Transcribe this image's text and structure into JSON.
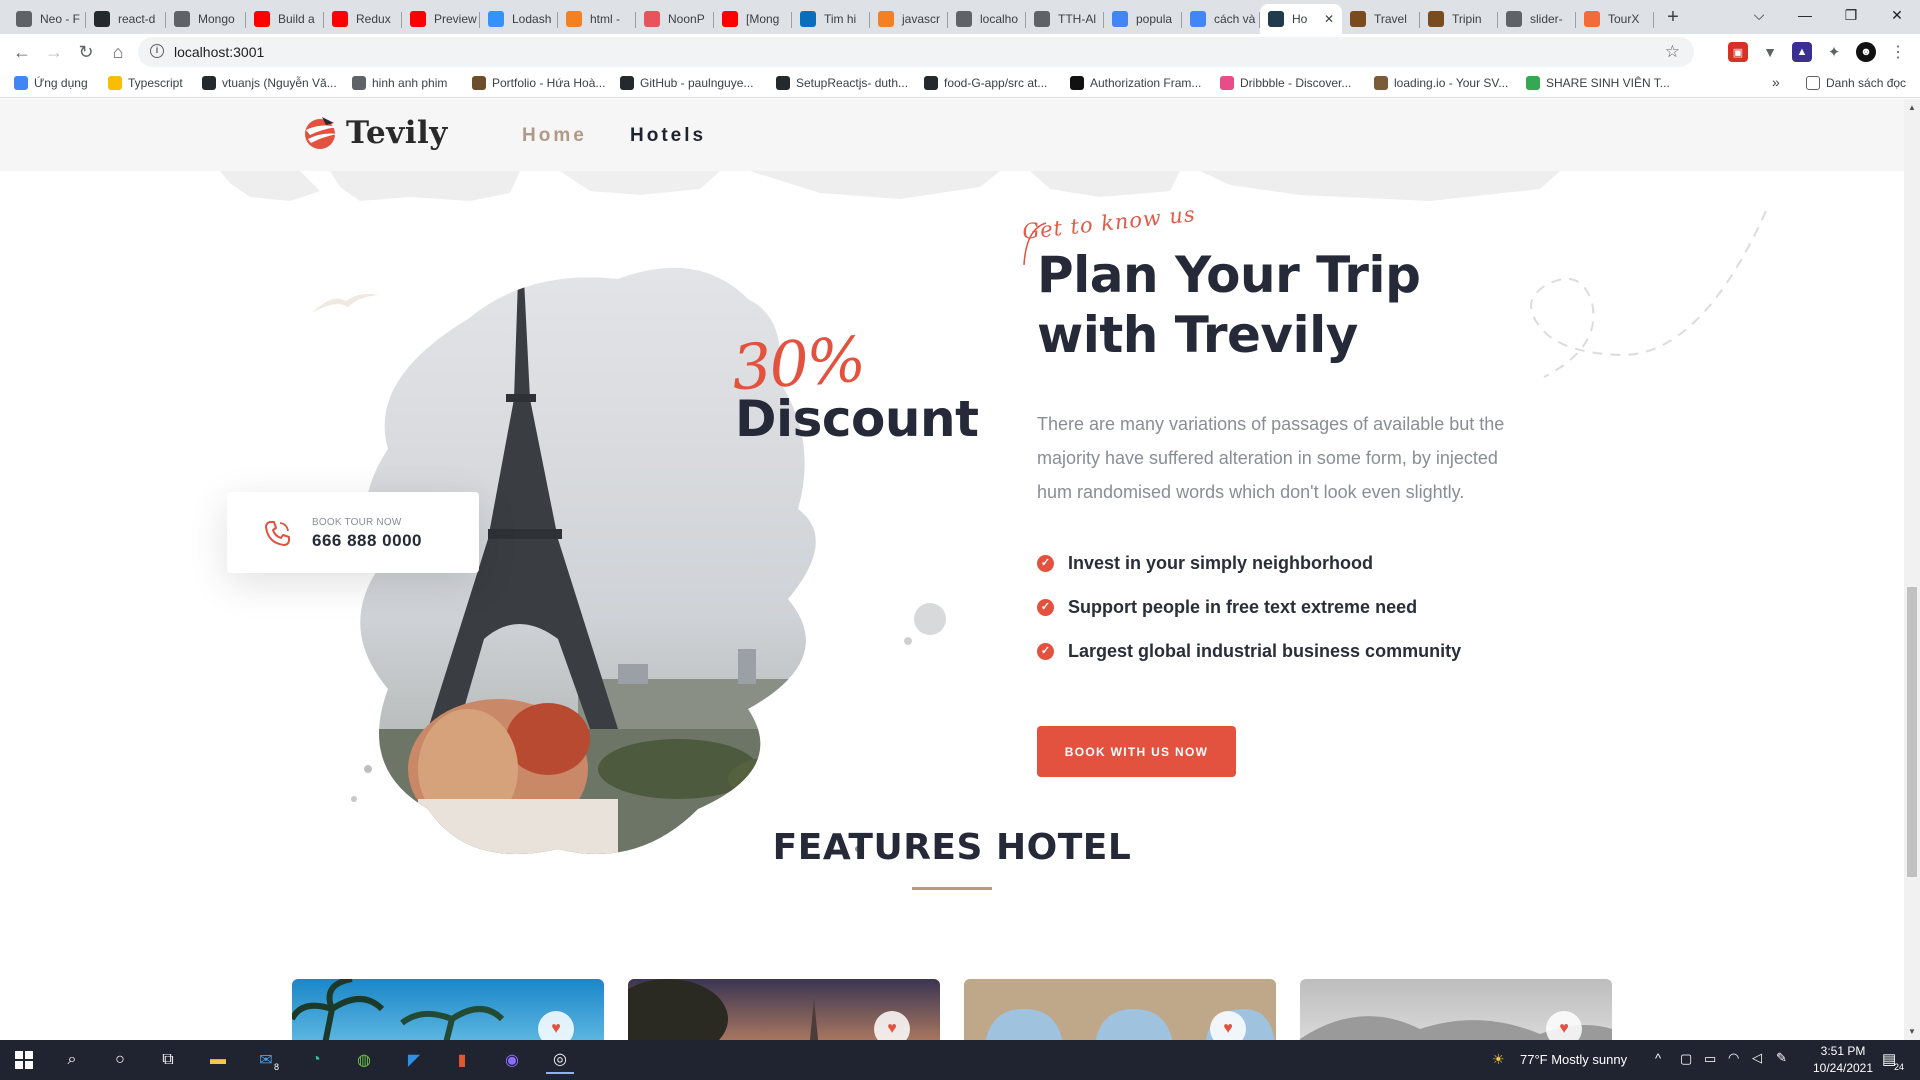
{
  "browser": {
    "tabs": [
      {
        "title": "Neo - F",
        "color": "#5f6368"
      },
      {
        "title": "react-d",
        "color": "#24292e"
      },
      {
        "title": "Mongo",
        "color": "#5f6368"
      },
      {
        "title": "Build a",
        "color": "#ff0000"
      },
      {
        "title": "Redux",
        "color": "#ff0000"
      },
      {
        "title": "Preview",
        "color": "#ff0000"
      },
      {
        "title": "Lodash",
        "color": "#3492ff"
      },
      {
        "title": "html -",
        "color": "#f48024"
      },
      {
        "title": "NoonP",
        "color": "#e8545c"
      },
      {
        "title": "[Mong",
        "color": "#ff0000"
      },
      {
        "title": "Tim hi",
        "color": "#0a6ebd"
      },
      {
        "title": "javascr",
        "color": "#f48024"
      },
      {
        "title": "localho",
        "color": "#5f6368"
      },
      {
        "title": "TTH-Al",
        "color": "#5f6368"
      },
      {
        "title": "popula",
        "color": "#4285f4"
      },
      {
        "title": "cách và",
        "color": "#4285f4"
      },
      {
        "title": "Ho",
        "color": "#1f3b4d",
        "active": true
      },
      {
        "title": "Travel",
        "color": "#7a4b1f"
      },
      {
        "title": "Tripin",
        "color": "#7a4b1f"
      },
      {
        "title": "slider-",
        "color": "#5f6368"
      },
      {
        "title": "TourX",
        "color": "#f36b3b"
      }
    ],
    "url": "localhost:3001",
    "bookmarks": [
      {
        "label": "Ứng dụng",
        "color": "#4285f4"
      },
      {
        "label": "Typescript",
        "color": "#fbbc05"
      },
      {
        "label": "vtuanjs (Nguyễn Vă...",
        "color": "#24292e"
      },
      {
        "label": "hinh anh phim",
        "color": "#5f6368"
      },
      {
        "label": "Portfolio - Hứa Hoà...",
        "color": "#6b4f2a"
      },
      {
        "label": "GitHub - paulnguye...",
        "color": "#24292e"
      },
      {
        "label": "SetupReactjs- duth...",
        "color": "#24292e"
      },
      {
        "label": "food-G-app/src at...",
        "color": "#24292e"
      },
      {
        "label": "Authorization Fram...",
        "color": "#111111"
      },
      {
        "label": "Dribbble - Discover...",
        "color": "#ea4c89"
      },
      {
        "label": "loading.io - Your SV...",
        "color": "#7a5b3a"
      },
      {
        "label": "SHARE SINH VIÊN T...",
        "color": "#34a853"
      }
    ],
    "bookmarks_more": "»",
    "reading_list": "Danh sách đọc"
  },
  "site": {
    "logo": "Tevily",
    "nav": [
      {
        "label": "Home",
        "color": "#b09a86"
      },
      {
        "label": "Hotels",
        "color": "#1f2230"
      }
    ],
    "about": {
      "tagline": "Get to know us",
      "headline": "Plan Your Trip with Trevily",
      "description": "There are many variations of passages of available but the majority have suffered alteration in some form, by injected hum randomised words which don't look even slightly.",
      "checklist": [
        "Invest in your simply neighborhood",
        "Support people in free text extreme need",
        "Largest global industrial business community"
      ],
      "cta": "BOOK WITH US NOW",
      "discount_value": "30%",
      "discount_label": "Discount",
      "book_label": "BOOK TOUR NOW",
      "book_phone": "666 888 0000"
    },
    "features": {
      "title": "FEATURES HOTEL",
      "cards": [
        {
          "name": "hotel-card-1"
        },
        {
          "name": "hotel-card-2"
        },
        {
          "name": "hotel-card-3"
        },
        {
          "name": "hotel-card-4"
        }
      ]
    },
    "accent": "#e2523f"
  },
  "taskbar": {
    "mail_badge": "8",
    "weather": "77°F  Mostly sunny",
    "time": "3:51 PM",
    "date": "10/24/2021",
    "notifications": "24"
  }
}
